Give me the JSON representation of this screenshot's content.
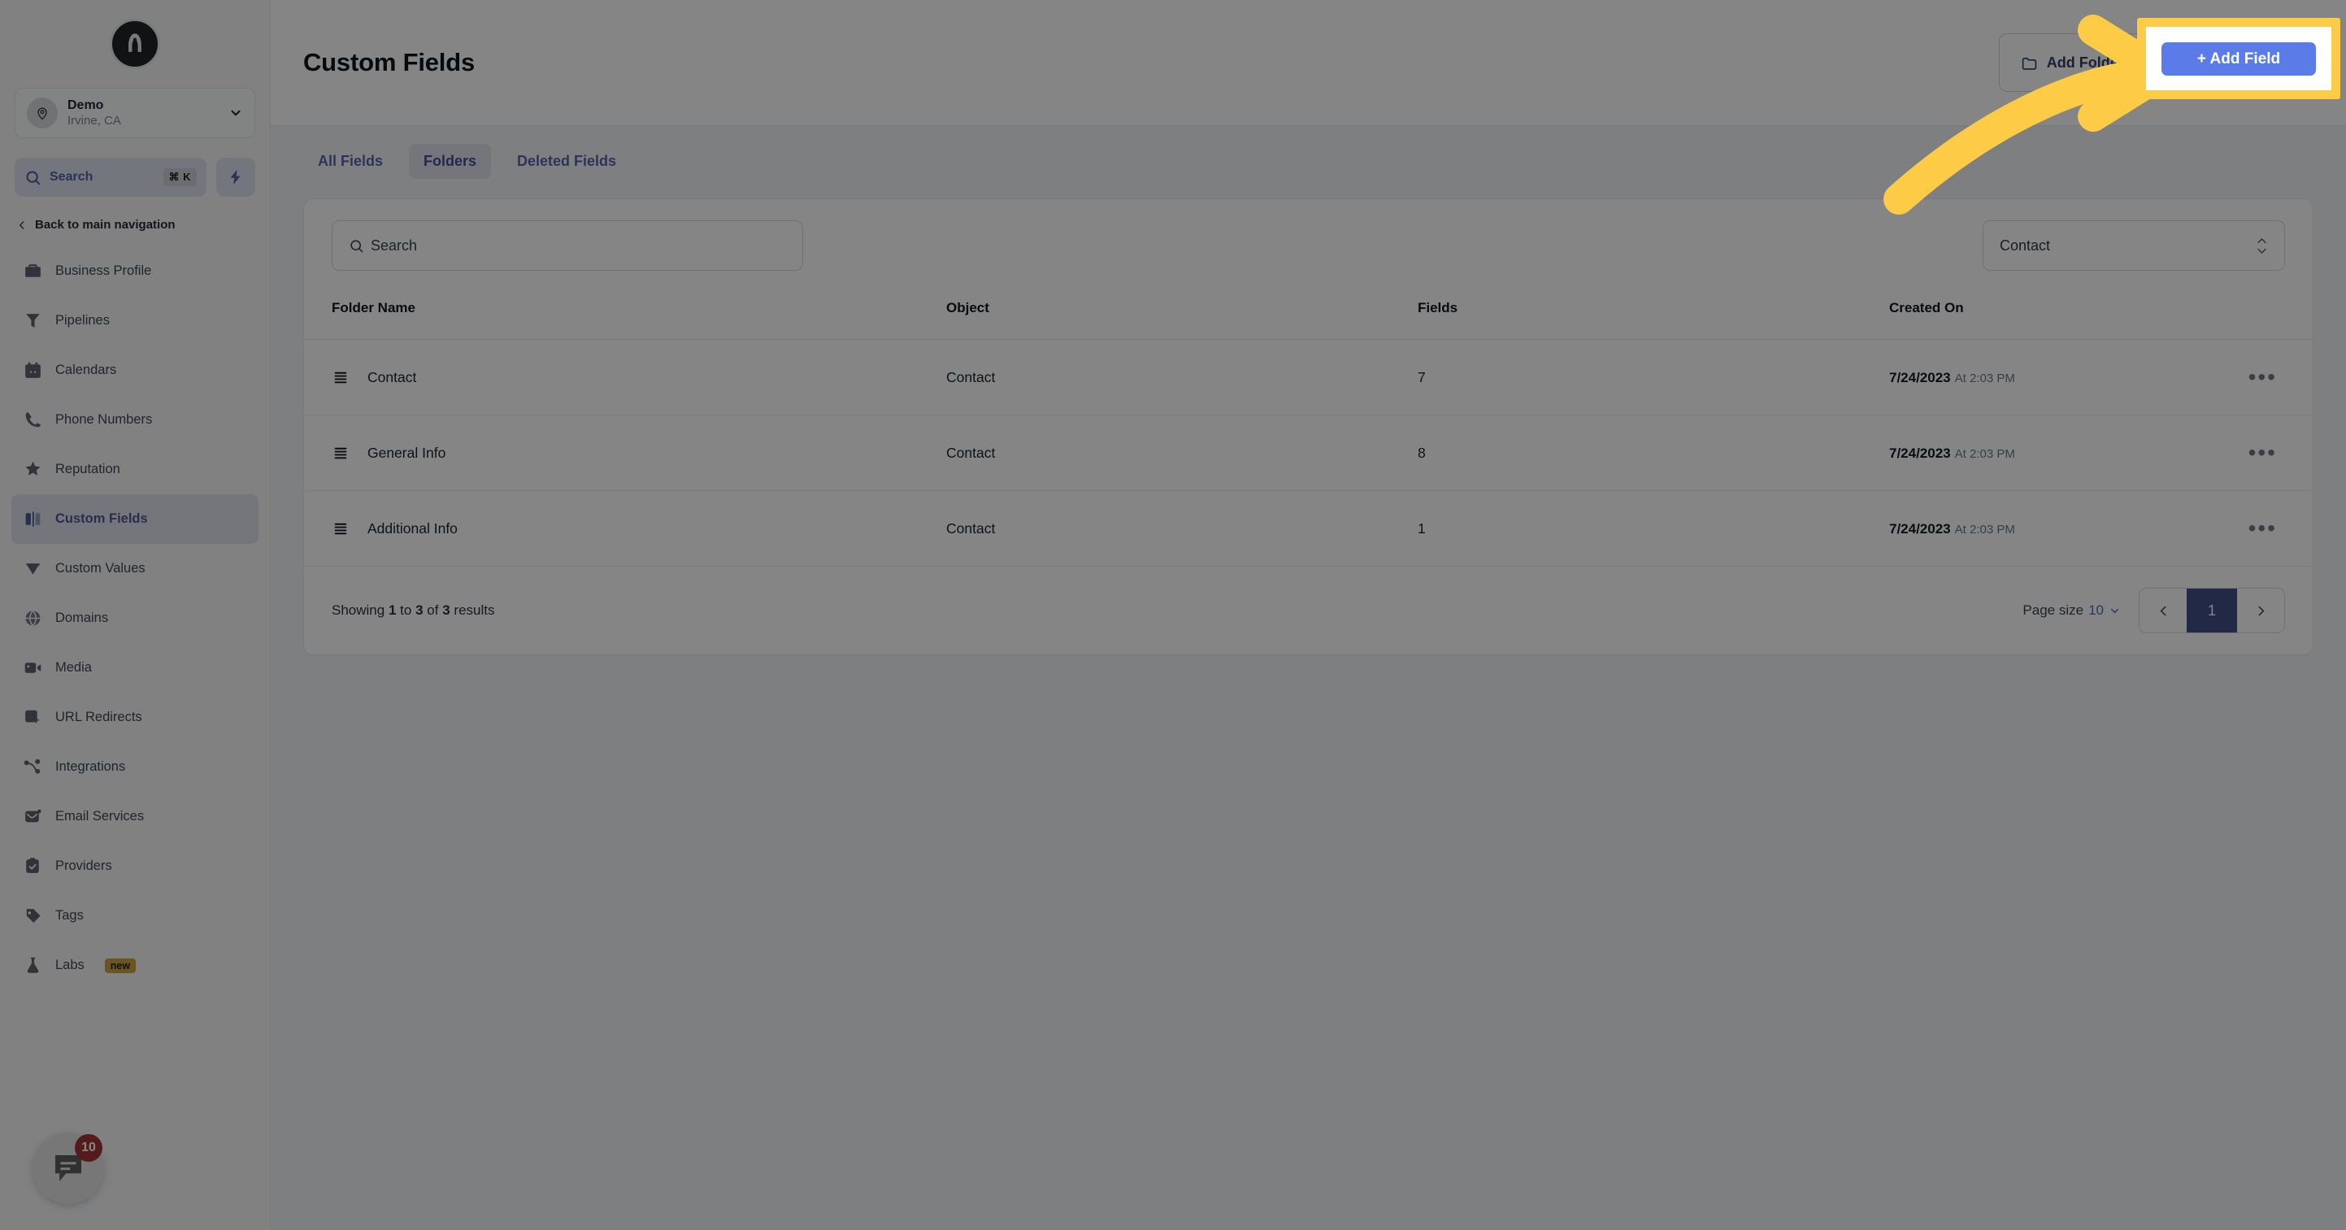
{
  "sidebar": {
    "logo_icon": "rocket-logo-icon",
    "location": {
      "icon": "location-pin-icon",
      "name": "Demo",
      "sub": "Irvine, CA",
      "chevron_icon": "chevron-down-icon"
    },
    "search": {
      "icon": "search-icon",
      "label": "Search",
      "shortcut": "⌘ K"
    },
    "bolt_icon": "lightning-bolt-icon",
    "back_nav": {
      "icon": "chevron-left-icon",
      "label": "Back to main navigation"
    },
    "items": [
      {
        "label": "Business Profile",
        "icon": "briefcase-icon",
        "active": false
      },
      {
        "label": "Pipelines",
        "icon": "funnel-icon",
        "active": false
      },
      {
        "label": "Calendars",
        "icon": "calendar-icon",
        "active": false
      },
      {
        "label": "Phone Numbers",
        "icon": "phone-icon",
        "active": false
      },
      {
        "label": "Reputation",
        "icon": "star-icon",
        "active": false
      },
      {
        "label": "Custom Fields",
        "icon": "columns-icon",
        "active": true
      },
      {
        "label": "Custom Values",
        "icon": "gem-icon",
        "active": false
      },
      {
        "label": "Domains",
        "icon": "globe-icon",
        "active": false
      },
      {
        "label": "Media",
        "icon": "video-icon",
        "active": false
      },
      {
        "label": "URL Redirects",
        "icon": "cursor-box-icon",
        "active": false
      },
      {
        "label": "Integrations",
        "icon": "nodes-icon",
        "active": false
      },
      {
        "label": "Email Services",
        "icon": "mail-icon",
        "active": false
      },
      {
        "label": "Providers",
        "icon": "clipboard-check-icon",
        "active": false
      },
      {
        "label": "Tags",
        "icon": "tag-icon",
        "active": false
      },
      {
        "label": "Labs",
        "icon": "flask-icon",
        "active": false,
        "badge": "new"
      }
    ],
    "chat": {
      "icon": "chat-bubble-icon",
      "badge": "10"
    }
  },
  "header": {
    "title": "Custom Fields",
    "add_folder_label": "Add Folder",
    "add_folder_icon": "folder-plus-icon",
    "add_field_label": "+ Add Field"
  },
  "tabs": [
    {
      "label": "All Fields",
      "active": false
    },
    {
      "label": "Folders",
      "active": true
    },
    {
      "label": "Deleted Fields",
      "active": false
    }
  ],
  "toolbar": {
    "search_placeholder": "Search",
    "search_icon": "search-icon",
    "object_filter_value": "Contact",
    "object_filter_icon": "chevron-updown-icon"
  },
  "table": {
    "columns": [
      "Folder Name",
      "Object",
      "Fields",
      "Created On"
    ],
    "drag_icon": "drag-handle-icon",
    "row_menu_icon": "ellipsis-icon",
    "rows": [
      {
        "name": "Contact",
        "object": "Contact",
        "fields": "7",
        "created_date": "7/24/2023",
        "created_time": "At 2:03 PM"
      },
      {
        "name": "General Info",
        "object": "Contact",
        "fields": "8",
        "created_date": "7/24/2023",
        "created_time": "At 2:03 PM"
      },
      {
        "name": "Additional Info",
        "object": "Contact",
        "fields": "1",
        "created_date": "7/24/2023",
        "created_time": "At 2:03 PM"
      }
    ]
  },
  "footer": {
    "showing_prefix": "Showing",
    "showing_from": "1",
    "showing_mid": "to",
    "showing_to": "3",
    "showing_of": "of",
    "showing_total": "3",
    "showing_suffix": "results",
    "page_size_label": "Page size",
    "page_size_value": "10",
    "prev_icon": "chevron-left-icon",
    "next_icon": "chevron-right-icon",
    "current_page": "1"
  },
  "annotation": {
    "highlight_color": "#FDCB45",
    "arrow_icon": "curved-arrow-icon",
    "highlighted_button_label": "+ Add Field"
  },
  "colors": {
    "accent_blue": "#4f6ae0",
    "active_nav_bg": "#dde2f3",
    "badge_new": "#d8a41a",
    "chat_badge_red": "#c22b2b",
    "highlight_yellow": "#FDCB45"
  }
}
